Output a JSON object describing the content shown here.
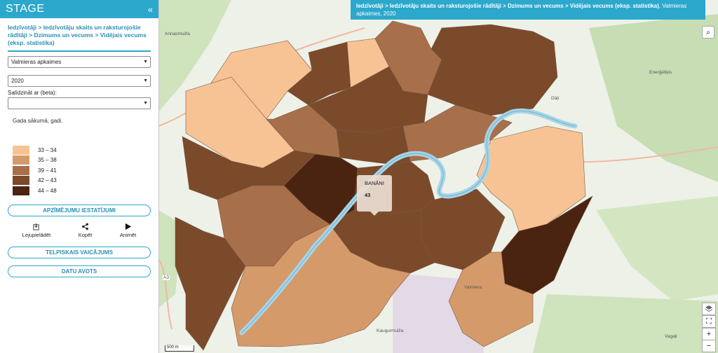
{
  "sidebar": {
    "brand": "STAGE",
    "collapse_glyph": "«",
    "breadcrumb": "Iedzīvotāji > Iedzīvotāju skaits un raksturojošie rādītāji > Dzimums un vecums > Vidējais vecums (eksp. statistika)",
    "territory_select": "Valmieras apkaimes",
    "year_select": "2020",
    "compare_label": "Salīdzināt ar (beta):",
    "compare_select": "",
    "note": "Gada sākumā, gadi.",
    "legend": [
      {
        "label": "33 – 34",
        "color": "#f7c395"
      },
      {
        "label": "35 – 38",
        "color": "#d59a6a"
      },
      {
        "label": "39 – 41",
        "color": "#a8704a"
      },
      {
        "label": "42 – 43",
        "color": "#7a4a2b"
      },
      {
        "label": "44 – 48",
        "color": "#4a2410"
      }
    ],
    "settings_button": "APZĪMĒJUMU IESTATĪJUMI",
    "actions": {
      "download": "Lejupielādēt",
      "copy": "Kopēt",
      "animate": "Animēt"
    },
    "query_button": "TELPISKAIS VAICĀJUMS",
    "source_button": "DATU AVOTS"
  },
  "map": {
    "title_bold": "Iedzīvotāji > Iedzīvotāju skaits un raksturojošie rādītāji > Dzimums un vecums > Vidējais vecums (eksp. statistika)",
    "title_rest": ", Valmieras apkaimes, 2020",
    "popup": {
      "name": "BANĀNI",
      "value": "43"
    },
    "scale": "500 m",
    "labels": {
      "annasmuiza": "Annasmuiža",
      "energetikis": "Enerģētiķis",
      "dalni": "Dāļi",
      "kaugurmuiza": "Kaugurmuiža",
      "valmiera": "Valmiera",
      "vagali": "Vagaļi",
      "a3": "A3"
    },
    "controls": {
      "zoom_in": "+",
      "zoom_out": "−",
      "fullscreen": "⛶",
      "layers": "layers"
    }
  }
}
